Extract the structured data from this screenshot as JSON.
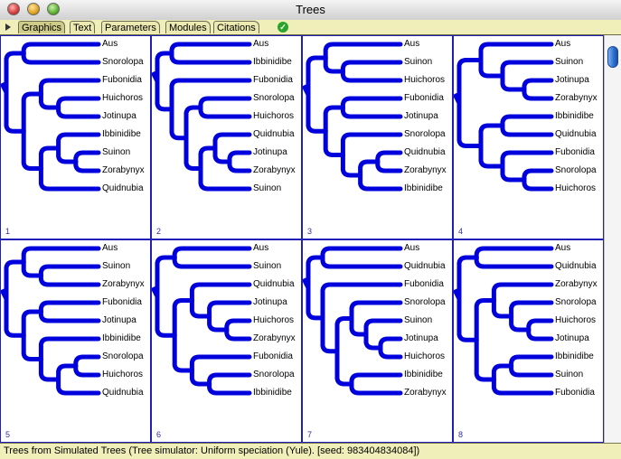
{
  "window": {
    "title": "Trees"
  },
  "tabs": [
    {
      "label": "Graphics",
      "active": true
    },
    {
      "label": "Text",
      "active": false
    },
    {
      "label": "Parameters",
      "active": false
    },
    {
      "label": "Modules",
      "active": false
    },
    {
      "label": "Citations",
      "active": false
    }
  ],
  "trees": [
    {
      "number": "1",
      "leaves": [
        "Aus",
        "Snorolopa",
        "Fubonidia",
        "Huichoros",
        "Jotinupa",
        "Ibbinidibe",
        "Suinon",
        "Zorabynyx",
        "Quidnubia"
      ]
    },
    {
      "number": "2",
      "leaves": [
        "Aus",
        "Ibbinidibe",
        "Fubonidia",
        "Snorolopa",
        "Huichoros",
        "Quidnubia",
        "Jotinupa",
        "Zorabynyx",
        "Suinon"
      ]
    },
    {
      "number": "3",
      "leaves": [
        "Aus",
        "Suinon",
        "Huichoros",
        "Fubonidia",
        "Jotinupa",
        "Snorolopa",
        "Quidnubia",
        "Zorabynyx",
        "Ibbinidibe"
      ]
    },
    {
      "number": "4",
      "leaves": [
        "Aus",
        "Suinon",
        "Jotinupa",
        "Zorabynyx",
        "Ibbinidibe",
        "Quidnubia",
        "Fubonidia",
        "Snorolopa",
        "Huichoros"
      ]
    },
    {
      "number": "5",
      "leaves": [
        "Aus",
        "Suinon",
        "Zorabynyx",
        "Fubonidia",
        "Jotinupa",
        "Ibbinidibe",
        "Snorolopa",
        "Huichoros",
        "Quidnubia"
      ]
    },
    {
      "number": "6",
      "leaves": [
        "Aus",
        "Suinon",
        "Quidnubia",
        "Jotinupa",
        "Huichoros",
        "Zorabynyx",
        "Fubonidia",
        "Snorolopa",
        "Ibbinidibe"
      ]
    },
    {
      "number": "7",
      "leaves": [
        "Aus",
        "Quidnubia",
        "Fubonidia",
        "Snorolopa",
        "Suinon",
        "Jotinupa",
        "Huichoros",
        "Ibbinidibe",
        "Zorabynyx"
      ]
    },
    {
      "number": "8",
      "leaves": [
        "Aus",
        "Quidnubia",
        "Zorabynyx",
        "Snorolopa",
        "Huichoros",
        "Jotinupa",
        "Ibbinidibe",
        "Suinon",
        "Fubonidia"
      ]
    }
  ],
  "colors": {
    "branch": "#0000dd",
    "tabbar": "#f0efb9",
    "cell_border": "#2020b8"
  },
  "icons": {
    "disclosure": "disclosure-triangle-icon",
    "ok": "checkmark-icon"
  },
  "status": {
    "text": "Trees from Simulated Trees (Tree simulator: Uniform speciation (Yule). [seed: 983404834084])"
  }
}
